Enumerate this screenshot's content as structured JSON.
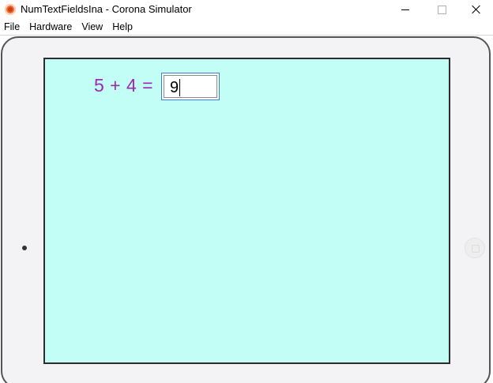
{
  "window": {
    "title": "NumTextFieldsIna - Corona Simulator",
    "icon": "corona-app-icon"
  },
  "menu": {
    "items": [
      {
        "label": "File"
      },
      {
        "label": "Hardware"
      },
      {
        "label": "View"
      },
      {
        "label": "Help"
      }
    ]
  },
  "app": {
    "equation": "5 + 4 =",
    "answer_value": "9"
  },
  "colors": {
    "screen_background": "#c2fef6",
    "equation_text": "#9a2ab0",
    "field_focus_border": "#3c7fd6"
  }
}
